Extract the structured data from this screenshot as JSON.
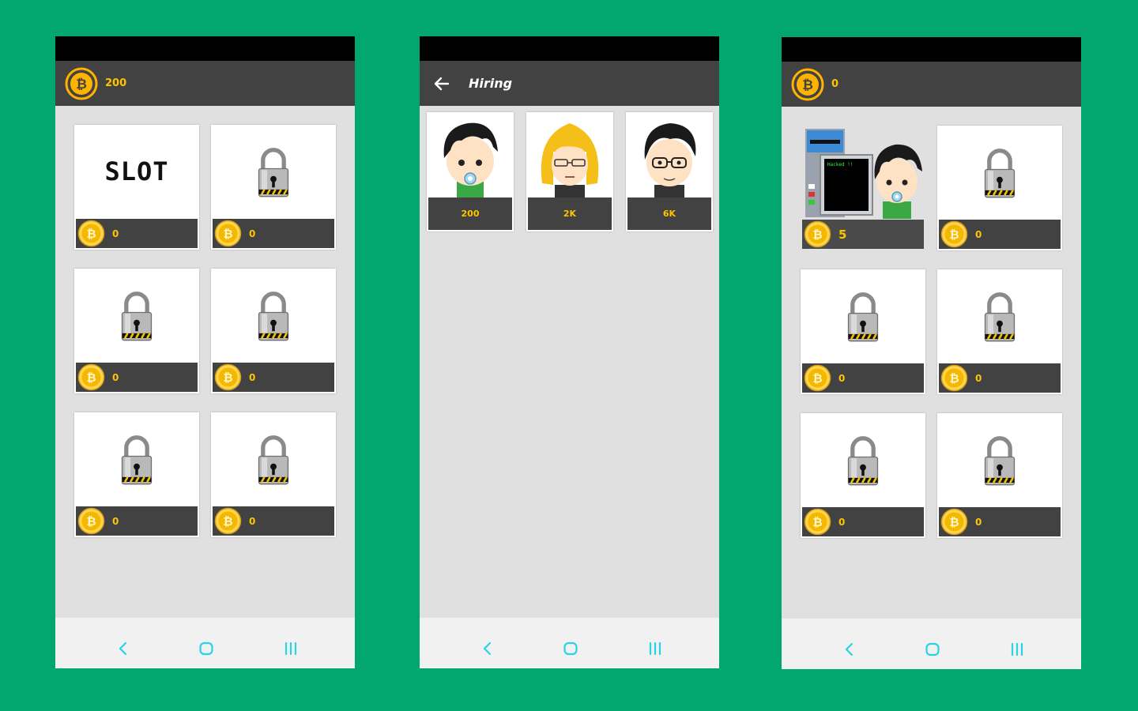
{
  "screens": [
    {
      "balance": "200",
      "cards": [
        {
          "art": "slot",
          "art_text": "SLOT",
          "price": "0"
        },
        {
          "art": "lock",
          "price": "0"
        },
        {
          "art": "lock",
          "price": "0"
        },
        {
          "art": "lock",
          "price": "0"
        },
        {
          "art": "lock",
          "price": "0"
        },
        {
          "art": "lock",
          "price": "0"
        }
      ]
    },
    {
      "title": "Hiring",
      "hires": [
        {
          "avatar": "boy-pacifier",
          "price": "200"
        },
        {
          "avatar": "blonde-glasses",
          "price": "2K"
        },
        {
          "avatar": "man-glasses",
          "price": "6K"
        }
      ]
    },
    {
      "balance": "0",
      "machine_screen_text": "Hacked !!",
      "cards": [
        {
          "art": "hacker-station",
          "price": "5"
        },
        {
          "art": "lock",
          "price": "0"
        },
        {
          "art": "lock",
          "price": "0"
        },
        {
          "art": "lock",
          "price": "0"
        },
        {
          "art": "lock",
          "price": "0"
        },
        {
          "art": "lock",
          "price": "0"
        }
      ]
    }
  ],
  "colors": {
    "background": "#02a76f",
    "app_bar": "#424242",
    "coin": "#ffc400",
    "nav_icon": "#29d3e6"
  }
}
